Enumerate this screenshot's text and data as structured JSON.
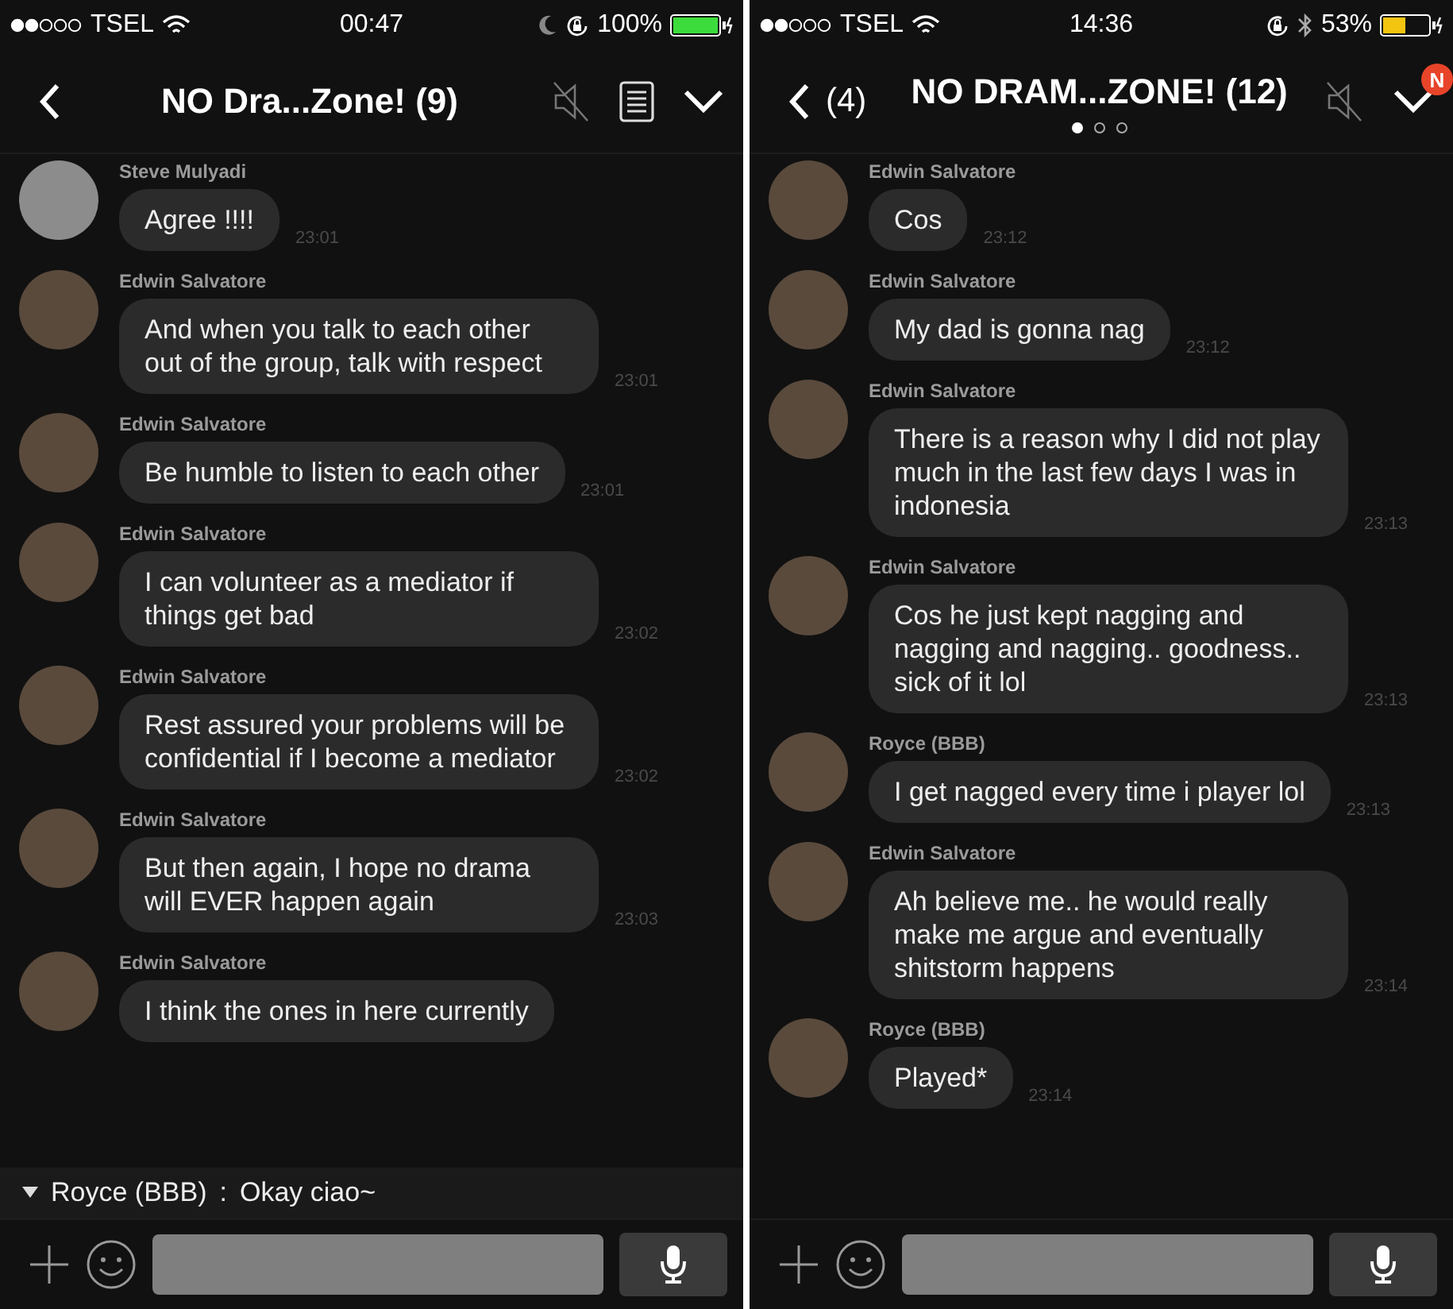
{
  "screens": [
    {
      "status_bar": {
        "carrier": "TSEL",
        "time": "00:47",
        "battery_text": "100%"
      },
      "nav": {
        "title": "NO Dra...Zone! (9)"
      },
      "messages": [
        {
          "sender": "Steve Mulyadi",
          "text": "Agree !!!!",
          "time": "23:01"
        },
        {
          "sender": "Edwin Salvatore",
          "text": "And when you talk to each other out of the group, talk with respect",
          "time": "23:01"
        },
        {
          "sender": "Edwin Salvatore",
          "text": "Be humble to listen to each other",
          "time": "23:01"
        },
        {
          "sender": "Edwin Salvatore",
          "text": "I can volunteer as a mediator if things get bad",
          "time": "23:02"
        },
        {
          "sender": "Edwin Salvatore",
          "text": "Rest assured your problems will be confidential if I become a mediator",
          "time": "23:02"
        },
        {
          "sender": "Edwin Salvatore",
          "text": "But then again, I hope no drama will EVER happen again",
          "time": "23:03"
        },
        {
          "sender": "Edwin Salvatore",
          "text": "I think the ones in here currently"
        }
      ],
      "notification": {
        "sender": "Royce (BBB)",
        "separator": ":",
        "text": "Okay ciao~"
      }
    },
    {
      "status_bar": {
        "carrier": "TSEL",
        "time": "14:36",
        "battery_text": "53%"
      },
      "nav": {
        "back_count": "(4)",
        "title": "NO DRAM...ZONE! (12)",
        "badge": "N",
        "pager_dots": [
          {
            "selected": true
          },
          {
            "selected": false
          },
          {
            "selected": false
          }
        ]
      },
      "messages": [
        {
          "sender": "Edwin Salvatore",
          "text": "Cos",
          "time": "23:12"
        },
        {
          "sender": "Edwin Salvatore",
          "text": "My dad is gonna nag",
          "time": "23:12"
        },
        {
          "sender": "Edwin Salvatore",
          "text": "There is a reason why I did not play much in the last few days I was in indonesia",
          "time": "23:13"
        },
        {
          "sender": "Edwin Salvatore",
          "text": "Cos he just kept nagging and nagging and nagging.. goodness.. sick of it lol",
          "time": "23:13"
        },
        {
          "sender": "Royce (BBB)",
          "text": "I get nagged every time i player lol",
          "time": "23:13"
        },
        {
          "sender": "Edwin Salvatore",
          "text": "Ah believe me.. he would really make me argue and eventually shitstorm happens",
          "time": "23:14"
        },
        {
          "sender": "Royce (BBB)",
          "text": "Played*",
          "time": "23:14"
        }
      ]
    }
  ]
}
